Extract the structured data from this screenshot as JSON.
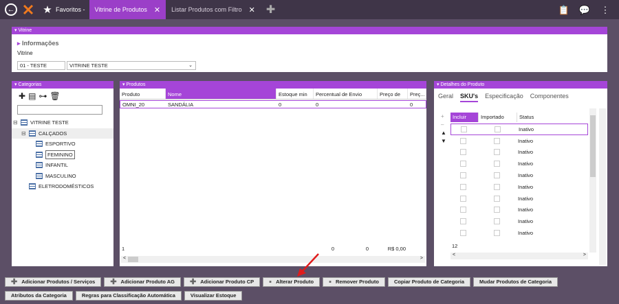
{
  "header": {
    "favorites_label": "Favoritos -",
    "tabs": [
      {
        "label": "Vitrine de Produtos",
        "active": true
      },
      {
        "label": "Listar Produtos com Filtro",
        "active": false
      }
    ]
  },
  "vitrine": {
    "panel_title": "Vitrine",
    "section_title": "Informações",
    "field_label": "Vitrine",
    "code_value": "01 - TESTE",
    "name_value": "VITRINE TESTE"
  },
  "categorias": {
    "panel_title": "Categorias",
    "tree": [
      {
        "label": "VITRINE TESTE",
        "level": 0
      },
      {
        "label": "CALÇADOS",
        "level": 1
      },
      {
        "label": "ESPORTIVO",
        "level": 2
      },
      {
        "label": "FEMININO",
        "level": 2
      },
      {
        "label": "INFANTIL",
        "level": 2
      },
      {
        "label": "MASCULINO",
        "level": 2
      },
      {
        "label": "ELETRODOMÉSTICOS",
        "level": 1
      }
    ]
  },
  "produtos": {
    "panel_title": "Produtos",
    "columns": [
      "Produto",
      "Nome",
      "Estoque min",
      "Percentual de Envio",
      "Preço de",
      "Preç..."
    ],
    "row": {
      "produto": "OMNI_20",
      "nome": "SANDÁLIA",
      "estoque": "0",
      "percentual": "0",
      "preco2": "0"
    },
    "footer": {
      "count": "1",
      "estoque": "0",
      "percentual": "0",
      "preco": "R$ 0,00"
    }
  },
  "detalhes": {
    "panel_title": "Detalhes do Produto",
    "tabs": [
      "Geral",
      "SKU's",
      "Especificação",
      "Componentes"
    ],
    "columns": [
      "Incluir",
      "Importado",
      "Status"
    ],
    "rows": [
      "Inativo",
      "Inativo",
      "Inativo",
      "Inativo",
      "Inativo",
      "Inativo",
      "Inativo",
      "Inativo",
      "Inativo",
      "Inativo"
    ],
    "count": "12"
  },
  "buttons_row1": [
    {
      "label": "Adicionar Produtos / Serviços",
      "plus": true
    },
    {
      "label": "Adicionar Produto AG",
      "plus": true
    },
    {
      "label": "Adicionar Produto CP",
      "plus": true
    },
    {
      "label": "Alterar Produto",
      "plus": true
    },
    {
      "label": "Remover Produto",
      "plus": true
    },
    {
      "label": "Copiar Produto de Categoria",
      "plus": false
    },
    {
      "label": "Mudar Produtos de Categoria",
      "plus": false
    }
  ],
  "buttons_row2": [
    {
      "label": "Atributos da Categoria"
    },
    {
      "label": "Regras para Classificação Automática"
    },
    {
      "label": "Visualizar Estoque"
    }
  ],
  "colors": {
    "accent": "#a545d8",
    "topbar": "#3f3548",
    "background": "#5c4f66"
  }
}
